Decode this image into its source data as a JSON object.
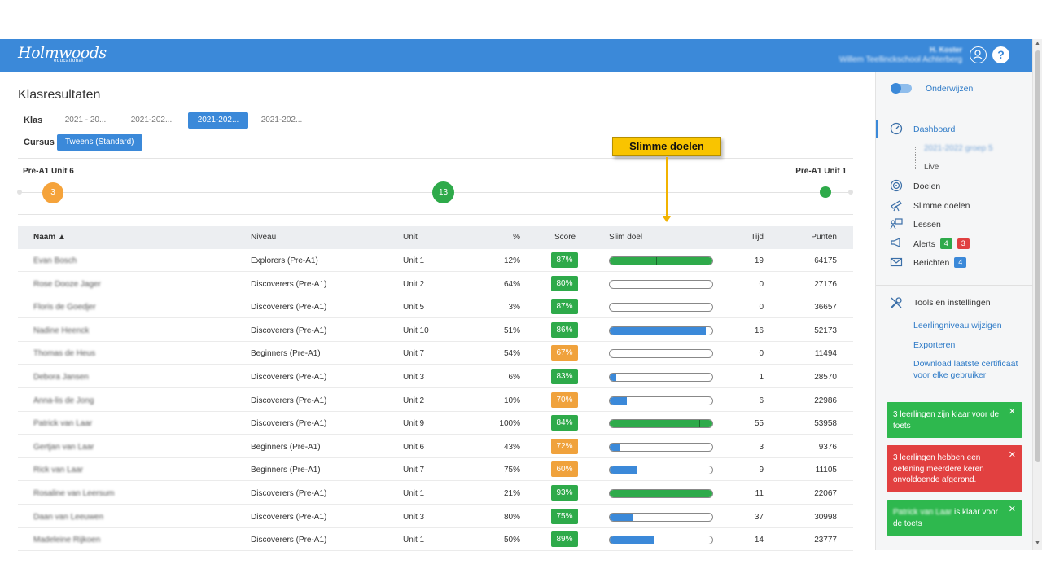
{
  "header": {
    "logo_text": "Holmwoods",
    "logo_sub": "educational",
    "user_name": "H. Koster",
    "user_school": "Willem Teellinckschool Achterberg",
    "help_label": "?"
  },
  "page": {
    "title": "Klasresultaten",
    "klas_label": "Klas",
    "classes": [
      "2021 - 20...",
      "2021-202...",
      "2021-202...",
      "2021-202..."
    ],
    "active_class_index": 2,
    "cursus_label": "Cursus",
    "course": "Tweens (Standard)"
  },
  "progress": {
    "start_label": "Pre-A1 Unit 6",
    "end_label": "Pre-A1 Unit 1",
    "marker_orange": "3",
    "marker_green": "13"
  },
  "callout": {
    "text": "Slimme doelen"
  },
  "table": {
    "headers": {
      "naam": "Naam ▲",
      "niveau": "Niveau",
      "unit": "Unit",
      "pct": "%",
      "score": "Score",
      "slim": "Slim doel",
      "tijd": "Tijd",
      "punten": "Punten"
    },
    "rows": [
      {
        "naam": "Evan Bosch",
        "niveau": "Explorers (Pre-A1)",
        "unit": "Unit 1",
        "pct": "12%",
        "score": "87%",
        "tijd": "19",
        "punten": "64175",
        "score_color": "#2eaa4a",
        "slim_fill": 1.0,
        "slim_color": "#2eaa4a",
        "slim_tick": 0.45
      },
      {
        "naam": "Rose Dooze Jager",
        "niveau": "Discoverers (Pre-A1)",
        "unit": "Unit 2",
        "pct": "64%",
        "score": "80%",
        "tijd": "0",
        "punten": "27176",
        "score_color": "#2eaa4a",
        "slim_fill": 0,
        "slim_color": "#3b89d9",
        "slim_tick": null
      },
      {
        "naam": "Floris de Goedjer",
        "niveau": "Discoverers (Pre-A1)",
        "unit": "Unit 5",
        "pct": "3%",
        "score": "87%",
        "tijd": "0",
        "punten": "36657",
        "score_color": "#2eaa4a",
        "slim_fill": 0,
        "slim_color": "#3b89d9",
        "slim_tick": null
      },
      {
        "naam": "Nadine Heenck",
        "niveau": "Discoverers (Pre-A1)",
        "unit": "Unit 10",
        "pct": "51%",
        "score": "86%",
        "tijd": "16",
        "punten": "52173",
        "score_color": "#2eaa4a",
        "slim_fill": 0.94,
        "slim_color": "#3b89d9",
        "slim_tick": null
      },
      {
        "naam": "Thomas de Heus",
        "niveau": "Beginners (Pre-A1)",
        "unit": "Unit 7",
        "pct": "54%",
        "score": "67%",
        "tijd": "0",
        "punten": "11494",
        "score_color": "#f0a23c",
        "slim_fill": 0,
        "slim_color": "#3b89d9",
        "slim_tick": null
      },
      {
        "naam": "Debora Jansen",
        "niveau": "Discoverers (Pre-A1)",
        "unit": "Unit 3",
        "pct": "6%",
        "score": "83%",
        "tijd": "1",
        "punten": "28570",
        "score_color": "#2eaa4a",
        "slim_fill": 0.06,
        "slim_color": "#3b89d9",
        "slim_tick": null
      },
      {
        "naam": "Anna-lis de Jong",
        "niveau": "Discoverers (Pre-A1)",
        "unit": "Unit 2",
        "pct": "10%",
        "score": "70%",
        "tijd": "6",
        "punten": "22986",
        "score_color": "#f0a23c",
        "slim_fill": 0.17,
        "slim_color": "#3b89d9",
        "slim_tick": null
      },
      {
        "naam": "Patrick van Laar",
        "niveau": "Discoverers (Pre-A1)",
        "unit": "Unit 9",
        "pct": "100%",
        "score": "84%",
        "tijd": "55",
        "punten": "53958",
        "score_color": "#2eaa4a",
        "slim_fill": 1.0,
        "slim_color": "#2eaa4a",
        "slim_tick": 0.87
      },
      {
        "naam": "Gertjan van Laar",
        "niveau": "Beginners (Pre-A1)",
        "unit": "Unit 6",
        "pct": "43%",
        "score": "72%",
        "tijd": "3",
        "punten": "9376",
        "score_color": "#f0a23c",
        "slim_fill": 0.1,
        "slim_color": "#3b89d9",
        "slim_tick": null
      },
      {
        "naam": "Rick van Laar",
        "niveau": "Beginners (Pre-A1)",
        "unit": "Unit 7",
        "pct": "75%",
        "score": "60%",
        "tijd": "9",
        "punten": "11105",
        "score_color": "#f0a23c",
        "slim_fill": 0.26,
        "slim_color": "#3b89d9",
        "slim_tick": null
      },
      {
        "naam": "Rosaline van Leersum",
        "niveau": "Discoverers (Pre-A1)",
        "unit": "Unit 1",
        "pct": "21%",
        "score": "93%",
        "tijd": "11",
        "punten": "22067",
        "score_color": "#2eaa4a",
        "slim_fill": 1.0,
        "slim_color": "#2eaa4a",
        "slim_tick": 0.73
      },
      {
        "naam": "Daan van Leeuwen",
        "niveau": "Discoverers (Pre-A1)",
        "unit": "Unit 3",
        "pct": "80%",
        "score": "75%",
        "tijd": "37",
        "punten": "30998",
        "score_color": "#2eaa4a",
        "slim_fill": 0.23,
        "slim_color": "#3b89d9",
        "slim_tick": null
      },
      {
        "naam": "Madeleine Rijkoen",
        "niveau": "Discoverers (Pre-A1)",
        "unit": "Unit 1",
        "pct": "50%",
        "score": "89%",
        "tijd": "14",
        "punten": "23777",
        "score_color": "#2eaa4a",
        "slim_fill": 0.43,
        "slim_color": "#3b89d9",
        "slim_tick": null
      }
    ]
  },
  "sidebar": {
    "toggle_label": "Onderwijzen",
    "dashboard": "Dashboard",
    "sub_group": "2021-2022 groep 5",
    "sub_live": "Live",
    "doelen": "Doelen",
    "slimme_doelen": "Slimme doelen",
    "lessen": "Lessen",
    "alerts": "Alerts",
    "alerts_green": "4",
    "alerts_red": "3",
    "berichten": "Berichten",
    "berichten_count": "4",
    "tools": "Tools en instellingen",
    "leerling": "Leerlingniveau wijzigen",
    "exporteren": "Exporteren",
    "download": "Download laatste certificaat voor elke gebruiker",
    "toast1": "3 leerlingen zijn klaar voor de toets",
    "toast2": "3 leerlingen hebben een oefening meerdere keren onvoldoende afgerond.",
    "toast3_name": "Patrick van Laar",
    "toast3_text": " is klaar voor de toets",
    "close": "✕"
  },
  "colors": {
    "accent": "#3b89d9",
    "green": "#2eaa4a",
    "orange": "#f0a23c",
    "red": "#e04040",
    "callout": "#f9c400"
  }
}
